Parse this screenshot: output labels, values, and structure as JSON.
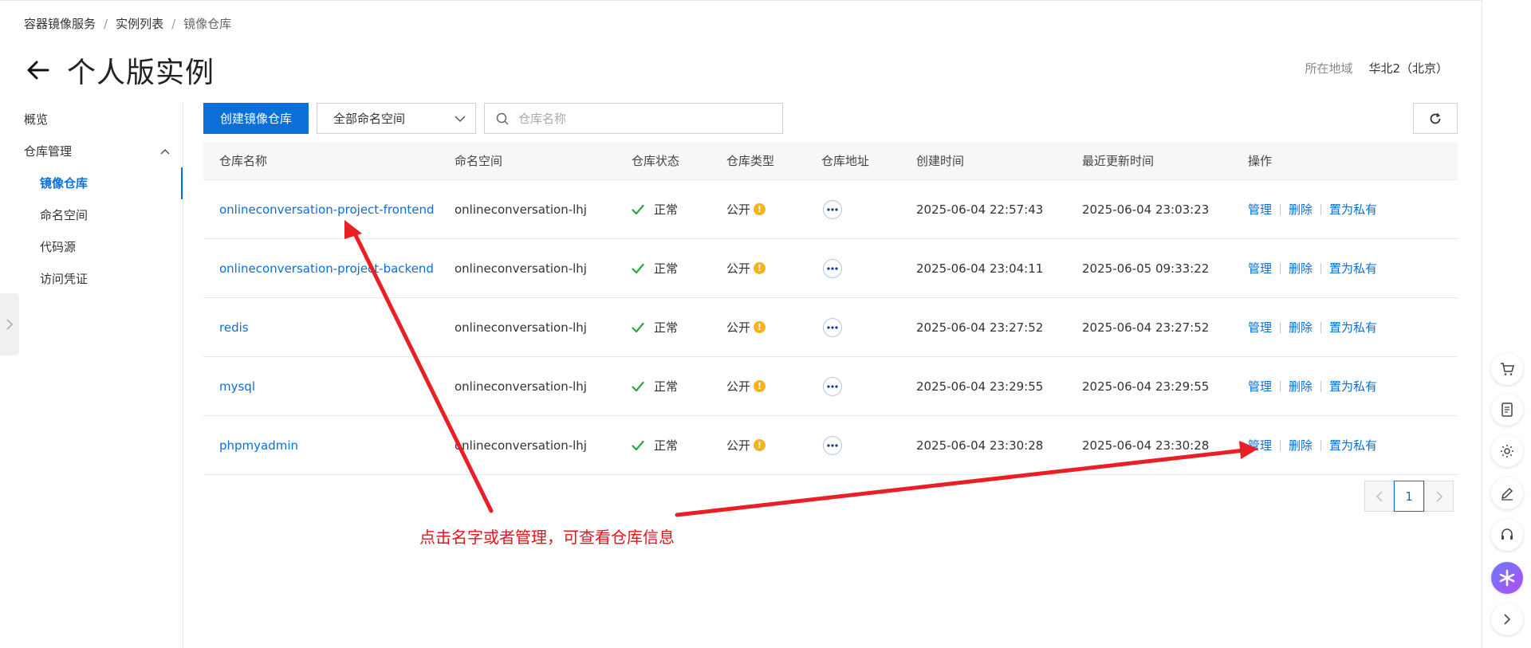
{
  "breadcrumb": [
    "容器镜像服务",
    "实例列表",
    "镜像仓库"
  ],
  "page_title": "个人版实例",
  "region": {
    "label": "所在地域",
    "value": "华北2（北京）"
  },
  "sidebar": {
    "overview": "概览",
    "group": "仓库管理",
    "items": [
      "镜像仓库",
      "命名空间",
      "代码源",
      "访问凭证"
    ]
  },
  "toolbar": {
    "create_label": "创建镜像仓库",
    "namespace_select": "全部命名空间",
    "search_placeholder": "仓库名称"
  },
  "table": {
    "headers": [
      "仓库名称",
      "命名空间",
      "仓库状态",
      "仓库类型",
      "仓库地址",
      "创建时间",
      "最近更新时间",
      "操作"
    ],
    "rows": [
      {
        "name": "onlineconversation-project-frontend",
        "namespace": "onlineconversation-lhj",
        "status": "正常",
        "type": "公开",
        "created": "2025-06-04 22:57:43",
        "updated": "2025-06-04 23:03:23"
      },
      {
        "name": "onlineconversation-project-backend",
        "namespace": "onlineconversation-lhj",
        "status": "正常",
        "type": "公开",
        "created": "2025-06-04 23:04:11",
        "updated": "2025-06-05 09:33:22"
      },
      {
        "name": "redis",
        "namespace": "onlineconversation-lhj",
        "status": "正常",
        "type": "公开",
        "created": "2025-06-04 23:27:52",
        "updated": "2025-06-04 23:27:52"
      },
      {
        "name": "mysql",
        "namespace": "onlineconversation-lhj",
        "status": "正常",
        "type": "公开",
        "created": "2025-06-04 23:29:55",
        "updated": "2025-06-04 23:29:55"
      },
      {
        "name": "phpmyadmin",
        "namespace": "onlineconversation-lhj",
        "status": "正常",
        "type": "公开",
        "created": "2025-06-04 23:30:28",
        "updated": "2025-06-04 23:30:28"
      }
    ],
    "ops": {
      "manage": "管理",
      "delete": "删除",
      "private": "置为私有"
    },
    "type_badge": "!"
  },
  "pagination": {
    "current": "1"
  },
  "annotation": {
    "text": "点击名字或者管理，可查看仓库信息",
    "color": "#e8141b"
  },
  "colors": {
    "accent": "#0b6fd8",
    "success": "#2da641",
    "warning": "#f5b21b"
  },
  "icons": {
    "back": "arrow-left-icon",
    "refresh": "refresh-icon",
    "search": "search-icon",
    "status": "check-icon",
    "address": "more-horizontal-icon"
  }
}
